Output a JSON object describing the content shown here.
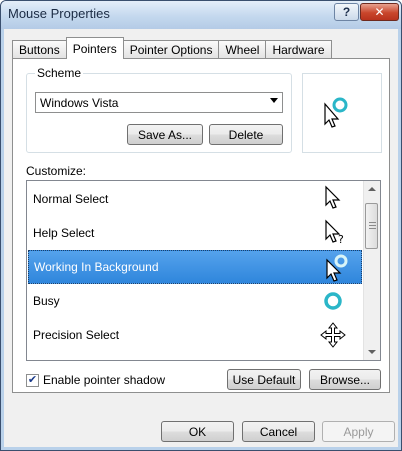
{
  "window": {
    "title": "Mouse Properties"
  },
  "titlebar": {
    "help_label": "?",
    "close_label": "✕"
  },
  "tabs": [
    {
      "label": "Buttons"
    },
    {
      "label": "Pointers"
    },
    {
      "label": "Pointer Options"
    },
    {
      "label": "Wheel"
    },
    {
      "label": "Hardware"
    }
  ],
  "active_tab": "Pointers",
  "scheme": {
    "group_label": "Scheme",
    "selected": "Windows Vista",
    "save_as_label": "Save As...",
    "delete_label": "Delete"
  },
  "customize": {
    "label": "Customize:",
    "items": [
      {
        "label": "Normal Select",
        "icon": "arrow-cursor-icon"
      },
      {
        "label": "Help Select",
        "icon": "help-cursor-icon"
      },
      {
        "label": "Working In Background",
        "icon": "working-cursor-icon",
        "selected": true
      },
      {
        "label": "Busy",
        "icon": "busy-ring-icon"
      },
      {
        "label": "Precision Select",
        "icon": "move-cursor-icon"
      }
    ]
  },
  "shadow": {
    "label": "Enable pointer shadow",
    "checked": true
  },
  "buttons": {
    "use_default": "Use Default",
    "browse": "Browse...",
    "ok": "OK",
    "cancel": "Cancel",
    "apply": "Apply"
  },
  "colors": {
    "selection": "#3c8ee0",
    "busy_ring": "#2bb6c8"
  }
}
